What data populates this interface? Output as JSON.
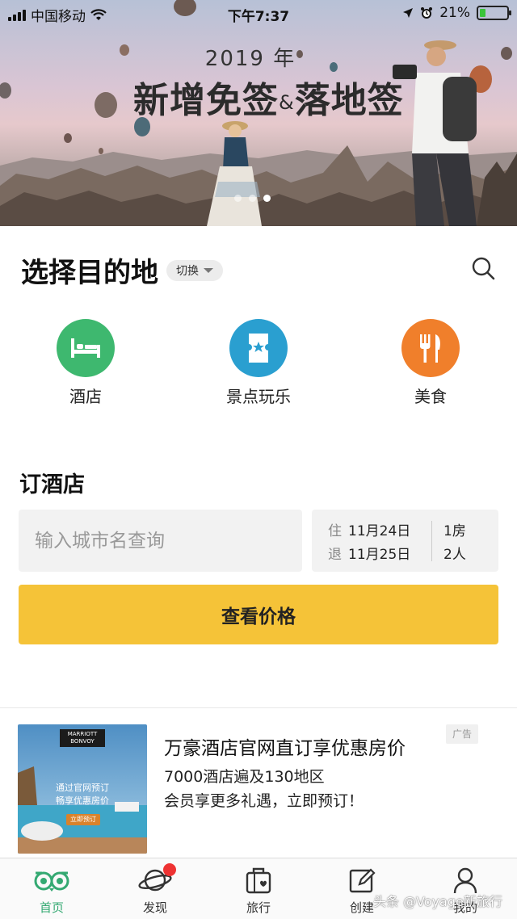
{
  "status_bar": {
    "carrier": "中国移动",
    "time": "下午7:37",
    "battery_percent_text": "21%",
    "battery_level": 0.21
  },
  "banner": {
    "year": "2019 年",
    "title_part1": "新增免签",
    "title_amp": "&",
    "title_part2": "落地签",
    "slide_count": 3,
    "active_slide": 2
  },
  "destination": {
    "title": "选择目的地",
    "switch_label": "切换"
  },
  "categories": [
    {
      "label": "酒店",
      "icon": "bed-icon",
      "color": "#3eb86f"
    },
    {
      "label": "景点玩乐",
      "icon": "ticket-icon",
      "color": "#2a9fd0"
    },
    {
      "label": "美食",
      "icon": "fork-knife-icon",
      "color": "#f07f2b"
    }
  ],
  "hotel": {
    "title": "订酒店",
    "city_placeholder": "输入城市名查询",
    "checkin_label": "住",
    "checkin_date": "11月24日",
    "checkout_label": "退",
    "checkout_date": "11月25日",
    "rooms": "1房",
    "guests": "2人",
    "price_button": "查看价格"
  },
  "ad": {
    "title": "万豪酒店官网直订享优惠房价",
    "line1": "7000酒店遍及130地区",
    "line2": "会员享更多礼遇，立即预订！",
    "badge": "广告",
    "image_logo": "MARRIOTT BONVOY",
    "image_text1": "通过官网预订",
    "image_text2": "畅享优惠房价",
    "image_cta": "立即预订"
  },
  "tabs": [
    {
      "label": "首页",
      "icon": "owl-eyes-icon",
      "active": true
    },
    {
      "label": "发现",
      "icon": "planet-icon",
      "active": false,
      "has_dot": true
    },
    {
      "label": "旅行",
      "icon": "suitcase-heart-icon",
      "active": false
    },
    {
      "label": "创建",
      "icon": "edit-icon",
      "active": false
    },
    {
      "label": "我的",
      "icon": "user-icon",
      "active": false
    }
  ],
  "watermark": "头条 @Voyage新旅行",
  "colors": {
    "accent_green": "#34a972",
    "button_yellow": "#f5c338",
    "badge_red": "#ee3333"
  }
}
